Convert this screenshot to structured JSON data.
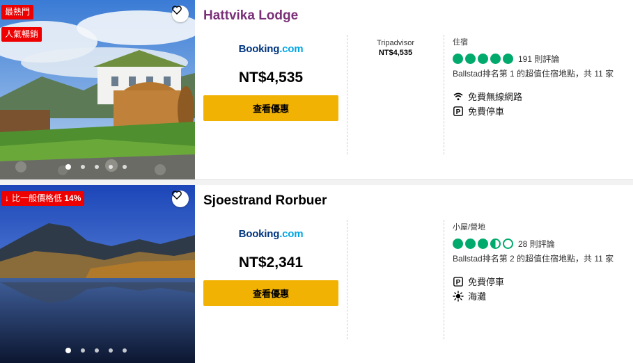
{
  "colors": {
    "brand_red": "#e00000",
    "cta_yellow": "#f2b203",
    "rating_green": "#00aa6c",
    "visited_title": "#7a3079",
    "booking_blue": "#003580",
    "booking_dotcom": "#00a6e3"
  },
  "listings": [
    {
      "badges": [
        "最熱門",
        "人氣暢銷"
      ],
      "name": "Hattvika Lodge",
      "provider_logo": {
        "main": "Booking",
        "suffix": ".com"
      },
      "price": "NT$4,535",
      "cta_label": "查看優惠",
      "other_offer": {
        "provider": "Tripadvisor",
        "price": "NT$4,535"
      },
      "type": "住宿",
      "rating_bubbles": 5,
      "reviews": "191 則評論",
      "rank": "Ballstad排名第 1 的超值住宿地點，共 11 家",
      "amenities": [
        {
          "icon": "wifi-icon",
          "label": "免費無線網路"
        },
        {
          "icon": "parking-icon",
          "label": "免費停車"
        }
      ],
      "carousel": {
        "count": 5,
        "active": 1
      }
    },
    {
      "badge_deal": {
        "prefix": "比一般價格低",
        "value": "14%"
      },
      "name": "Sjoestrand Rorbuer",
      "provider_logo": {
        "main": "Booking",
        "suffix": ".com"
      },
      "price": "NT$2,341",
      "cta_label": "查看優惠",
      "type": "小屋/營地",
      "rating_bubbles": 3.5,
      "reviews": "28 則評論",
      "rank": "Ballstad排名第 2 的超值住宿地點，共 11 家",
      "amenities": [
        {
          "icon": "parking-icon",
          "label": "免費停車"
        },
        {
          "icon": "beach-icon",
          "label": "海灘"
        }
      ],
      "carousel": {
        "count": 5,
        "active": 1
      }
    }
  ]
}
